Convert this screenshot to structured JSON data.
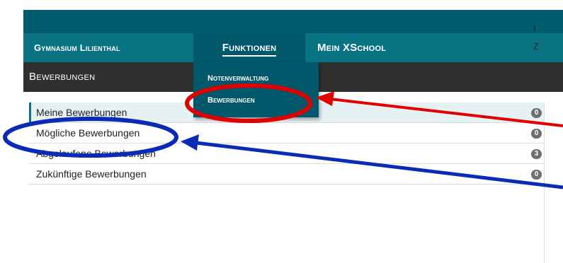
{
  "navbar": {
    "school_label": "Gymnasium Lilienthal",
    "funktionen_label": "Funktionen",
    "mein_label": "Mein XSchool"
  },
  "dropdown": {
    "items": [
      "Notenverwaltung",
      "Bewerbungen"
    ]
  },
  "page": {
    "title": "Bewerbungen"
  },
  "list": {
    "items": [
      {
        "label": "Meine Bewerbungen",
        "count": "0",
        "active": true
      },
      {
        "label": "Mögliche Bewerbungen",
        "count": "0",
        "active": false
      },
      {
        "label": "Abgelaufene Bewerbungen",
        "count": "3",
        "active": false
      },
      {
        "label": "Zukünftige Bewerbungen",
        "count": "0",
        "active": false
      }
    ]
  },
  "right_panel": {
    "line1": "I",
    "line2": "Z"
  },
  "annotations": {
    "red_color": "#e00000",
    "blue_color": "#0a2bb5"
  }
}
